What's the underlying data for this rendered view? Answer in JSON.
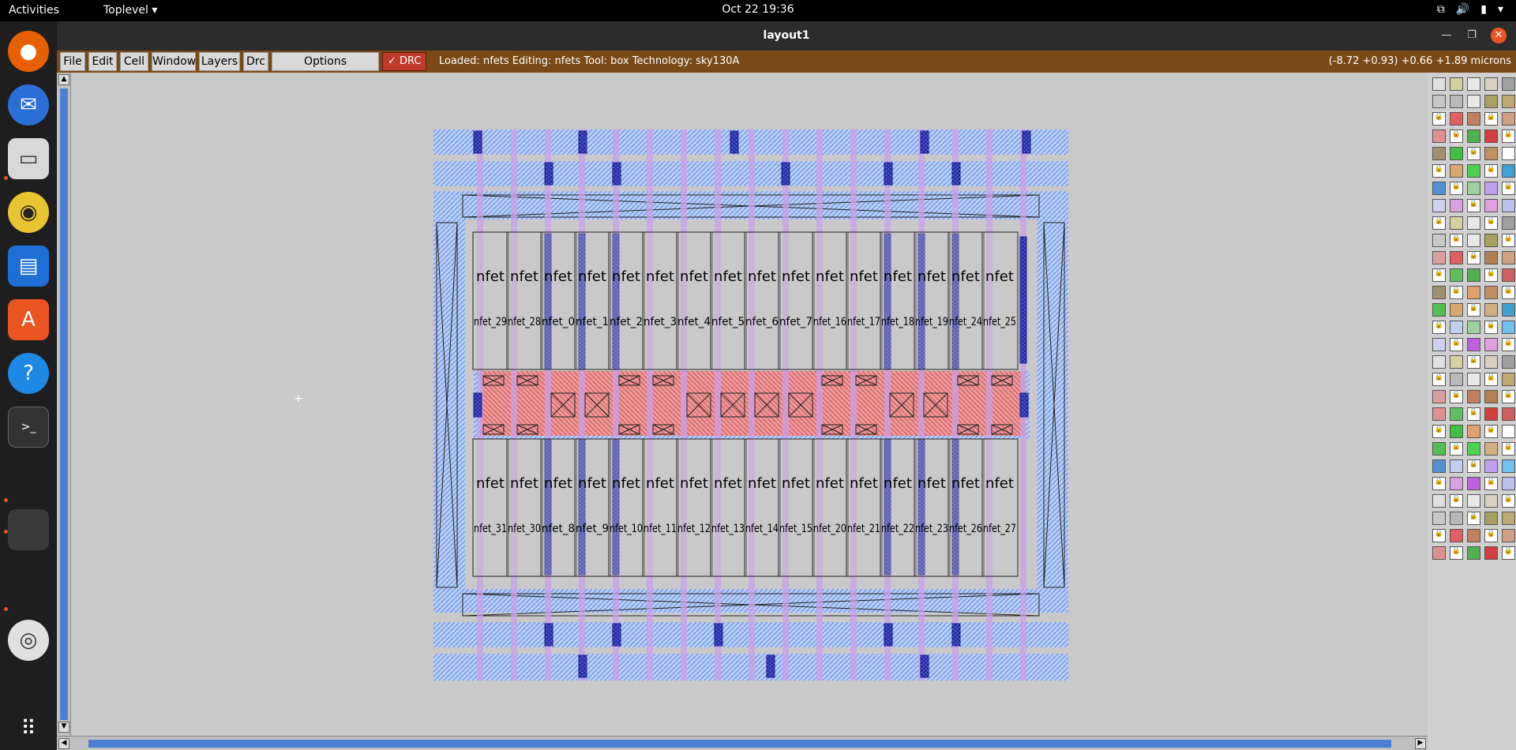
{
  "topbar": {
    "activities": "Activities",
    "app_menu": "Toplevel ▾",
    "clock": "Oct 22  19:36"
  },
  "window": {
    "title": "layout1"
  },
  "menu": {
    "file": "File",
    "edit": "Edit",
    "cell": "Cell",
    "window": "Window",
    "layers": "Layers",
    "drc": "Drc",
    "options": "Options",
    "drc_toggle": "✓ DRC"
  },
  "status": {
    "text": "Loaded: nfets  Editing: nfets  Tool: box   Technology: sky130A",
    "coords": "(-8.72 +0.93) +0.66 +1.89 microns"
  },
  "layout": {
    "device_label": "nfet",
    "top_row": [
      "nfet_29",
      "nfet_28",
      "nfet_0",
      "nfet_1",
      "nfet_2",
      "nfet_3",
      "nfet_4",
      "nfet_5",
      "nfet_6",
      "nfet_7",
      "nfet_16",
      "nfet_17",
      "nfet_18",
      "nfet_19",
      "nfet_24",
      "nfet_25"
    ],
    "bottom_row": [
      "nfet_31",
      "nfet_30",
      "nfet_8",
      "nfet_9",
      "nfet_10",
      "nfet_11",
      "nfet_12",
      "nfet_13",
      "nfet_14",
      "nfet_15",
      "nfet_20",
      "nfet_21",
      "nfet_22",
      "nfet_23",
      "nfet_26",
      "nfet_27"
    ]
  },
  "colors": {
    "metal1": "#7aa7f5",
    "poly": "#c9a0e8",
    "diff": "#e07070",
    "local": "#3333cc",
    "menubar": "#7a4a16"
  }
}
